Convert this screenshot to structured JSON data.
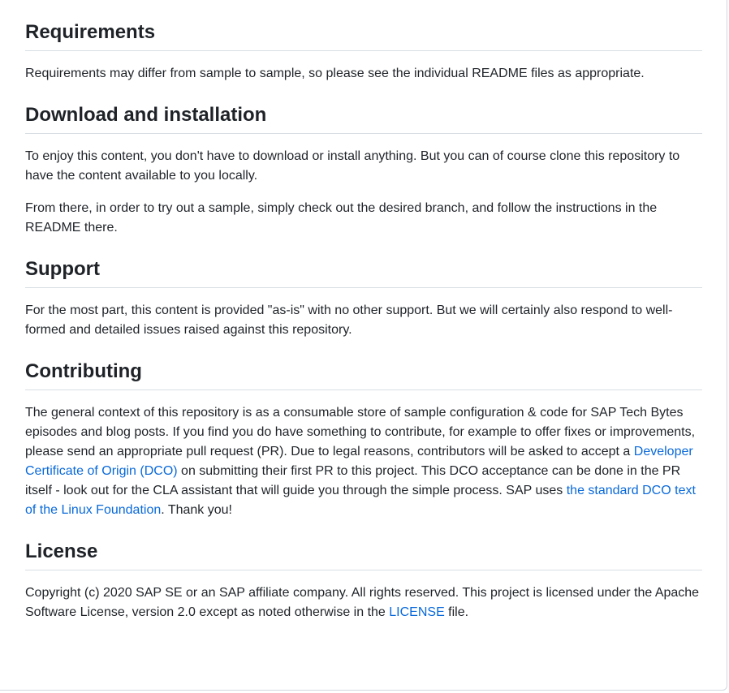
{
  "sections": [
    {
      "heading": "Requirements",
      "paragraphs": [
        "Requirements may differ from sample to sample, so please see the individual README files as appropriate."
      ]
    },
    {
      "heading": "Download and installation",
      "paragraphs": [
        "To enjoy this content, you don't have to download or install anything. But you can of course clone this repository to have the content available to you locally.",
        "From there, in order to try out a sample, simply check out the desired branch, and follow the instructions in the README there."
      ]
    },
    {
      "heading": "Support",
      "paragraphs": [
        "For the most part, this content is provided \"as-is\" with no other support. But we will certainly also respond to well-formed and detailed issues raised against this repository."
      ]
    },
    {
      "heading": "Contributing",
      "text1": "The general context of this repository is as a consumable store of sample configuration & code for SAP Tech Bytes episodes and blog posts. If you find you do have something to contribute, for example to offer fixes or improvements, please send an appropriate pull request (PR). Due to legal reasons, contributors will be asked to accept a ",
      "link1": "Developer Certificate of Origin (DCO)",
      "text2": " on submitting their first PR to this project. This DCO acceptance can be done in the PR itself - look out for the CLA assistant that will guide you through the simple process. SAP uses ",
      "link2": "the standard DCO text of the Linux Foundation",
      "text3": ". Thank you!"
    },
    {
      "heading": "License",
      "text1": "Copyright (c) 2020 SAP SE or an SAP affiliate company. All rights reserved. This project is licensed under the Apache Software License, version 2.0 except as noted otherwise in the ",
      "link1": "LICENSE",
      "text2": " file."
    }
  ],
  "colors": {
    "link": "#0969da",
    "text": "#1f2328"
  }
}
